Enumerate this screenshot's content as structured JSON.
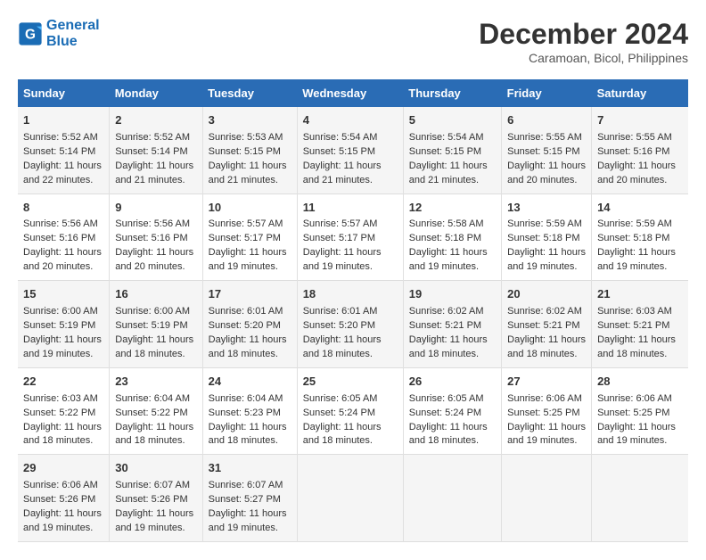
{
  "header": {
    "logo_line1": "General",
    "logo_line2": "Blue",
    "month_year": "December 2024",
    "location": "Caramoan, Bicol, Philippines"
  },
  "columns": [
    "Sunday",
    "Monday",
    "Tuesday",
    "Wednesday",
    "Thursday",
    "Friday",
    "Saturday"
  ],
  "weeks": [
    {
      "days": [
        {
          "num": "1",
          "sunrise": "Sunrise: 5:52 AM",
          "sunset": "Sunset: 5:14 PM",
          "daylight": "Daylight: 11 hours and 22 minutes."
        },
        {
          "num": "2",
          "sunrise": "Sunrise: 5:52 AM",
          "sunset": "Sunset: 5:14 PM",
          "daylight": "Daylight: 11 hours and 21 minutes."
        },
        {
          "num": "3",
          "sunrise": "Sunrise: 5:53 AM",
          "sunset": "Sunset: 5:15 PM",
          "daylight": "Daylight: 11 hours and 21 minutes."
        },
        {
          "num": "4",
          "sunrise": "Sunrise: 5:54 AM",
          "sunset": "Sunset: 5:15 PM",
          "daylight": "Daylight: 11 hours and 21 minutes."
        },
        {
          "num": "5",
          "sunrise": "Sunrise: 5:54 AM",
          "sunset": "Sunset: 5:15 PM",
          "daylight": "Daylight: 11 hours and 21 minutes."
        },
        {
          "num": "6",
          "sunrise": "Sunrise: 5:55 AM",
          "sunset": "Sunset: 5:15 PM",
          "daylight": "Daylight: 11 hours and 20 minutes."
        },
        {
          "num": "7",
          "sunrise": "Sunrise: 5:55 AM",
          "sunset": "Sunset: 5:16 PM",
          "daylight": "Daylight: 11 hours and 20 minutes."
        }
      ]
    },
    {
      "days": [
        {
          "num": "8",
          "sunrise": "Sunrise: 5:56 AM",
          "sunset": "Sunset: 5:16 PM",
          "daylight": "Daylight: 11 hours and 20 minutes."
        },
        {
          "num": "9",
          "sunrise": "Sunrise: 5:56 AM",
          "sunset": "Sunset: 5:16 PM",
          "daylight": "Daylight: 11 hours and 20 minutes."
        },
        {
          "num": "10",
          "sunrise": "Sunrise: 5:57 AM",
          "sunset": "Sunset: 5:17 PM",
          "daylight": "Daylight: 11 hours and 19 minutes."
        },
        {
          "num": "11",
          "sunrise": "Sunrise: 5:57 AM",
          "sunset": "Sunset: 5:17 PM",
          "daylight": "Daylight: 11 hours and 19 minutes."
        },
        {
          "num": "12",
          "sunrise": "Sunrise: 5:58 AM",
          "sunset": "Sunset: 5:18 PM",
          "daylight": "Daylight: 11 hours and 19 minutes."
        },
        {
          "num": "13",
          "sunrise": "Sunrise: 5:59 AM",
          "sunset": "Sunset: 5:18 PM",
          "daylight": "Daylight: 11 hours and 19 minutes."
        },
        {
          "num": "14",
          "sunrise": "Sunrise: 5:59 AM",
          "sunset": "Sunset: 5:18 PM",
          "daylight": "Daylight: 11 hours and 19 minutes."
        }
      ]
    },
    {
      "days": [
        {
          "num": "15",
          "sunrise": "Sunrise: 6:00 AM",
          "sunset": "Sunset: 5:19 PM",
          "daylight": "Daylight: 11 hours and 19 minutes."
        },
        {
          "num": "16",
          "sunrise": "Sunrise: 6:00 AM",
          "sunset": "Sunset: 5:19 PM",
          "daylight": "Daylight: 11 hours and 18 minutes."
        },
        {
          "num": "17",
          "sunrise": "Sunrise: 6:01 AM",
          "sunset": "Sunset: 5:20 PM",
          "daylight": "Daylight: 11 hours and 18 minutes."
        },
        {
          "num": "18",
          "sunrise": "Sunrise: 6:01 AM",
          "sunset": "Sunset: 5:20 PM",
          "daylight": "Daylight: 11 hours and 18 minutes."
        },
        {
          "num": "19",
          "sunrise": "Sunrise: 6:02 AM",
          "sunset": "Sunset: 5:21 PM",
          "daylight": "Daylight: 11 hours and 18 minutes."
        },
        {
          "num": "20",
          "sunrise": "Sunrise: 6:02 AM",
          "sunset": "Sunset: 5:21 PM",
          "daylight": "Daylight: 11 hours and 18 minutes."
        },
        {
          "num": "21",
          "sunrise": "Sunrise: 6:03 AM",
          "sunset": "Sunset: 5:21 PM",
          "daylight": "Daylight: 11 hours and 18 minutes."
        }
      ]
    },
    {
      "days": [
        {
          "num": "22",
          "sunrise": "Sunrise: 6:03 AM",
          "sunset": "Sunset: 5:22 PM",
          "daylight": "Daylight: 11 hours and 18 minutes."
        },
        {
          "num": "23",
          "sunrise": "Sunrise: 6:04 AM",
          "sunset": "Sunset: 5:22 PM",
          "daylight": "Daylight: 11 hours and 18 minutes."
        },
        {
          "num": "24",
          "sunrise": "Sunrise: 6:04 AM",
          "sunset": "Sunset: 5:23 PM",
          "daylight": "Daylight: 11 hours and 18 minutes."
        },
        {
          "num": "25",
          "sunrise": "Sunrise: 6:05 AM",
          "sunset": "Sunset: 5:24 PM",
          "daylight": "Daylight: 11 hours and 18 minutes."
        },
        {
          "num": "26",
          "sunrise": "Sunrise: 6:05 AM",
          "sunset": "Sunset: 5:24 PM",
          "daylight": "Daylight: 11 hours and 18 minutes."
        },
        {
          "num": "27",
          "sunrise": "Sunrise: 6:06 AM",
          "sunset": "Sunset: 5:25 PM",
          "daylight": "Daylight: 11 hours and 19 minutes."
        },
        {
          "num": "28",
          "sunrise": "Sunrise: 6:06 AM",
          "sunset": "Sunset: 5:25 PM",
          "daylight": "Daylight: 11 hours and 19 minutes."
        }
      ]
    },
    {
      "days": [
        {
          "num": "29",
          "sunrise": "Sunrise: 6:06 AM",
          "sunset": "Sunset: 5:26 PM",
          "daylight": "Daylight: 11 hours and 19 minutes."
        },
        {
          "num": "30",
          "sunrise": "Sunrise: 6:07 AM",
          "sunset": "Sunset: 5:26 PM",
          "daylight": "Daylight: 11 hours and 19 minutes."
        },
        {
          "num": "31",
          "sunrise": "Sunrise: 6:07 AM",
          "sunset": "Sunset: 5:27 PM",
          "daylight": "Daylight: 11 hours and 19 minutes."
        },
        null,
        null,
        null,
        null
      ]
    }
  ]
}
